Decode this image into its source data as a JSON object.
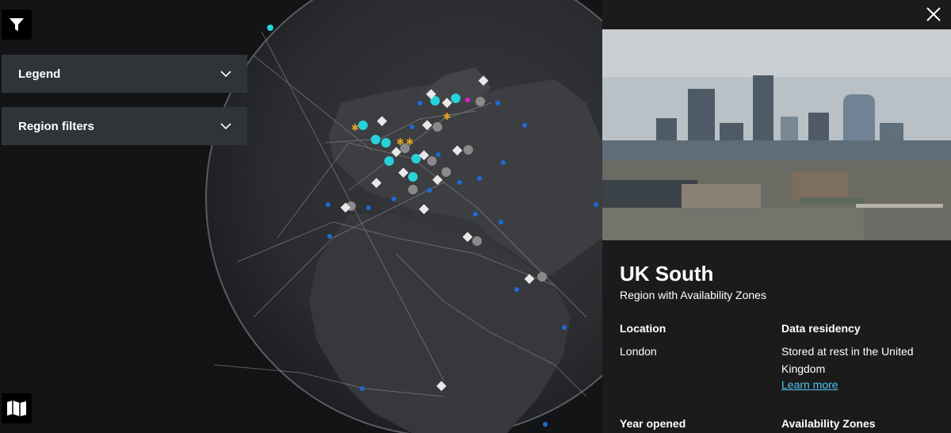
{
  "toolbar": {
    "filter_icon": "filter-icon",
    "map_icon": "map-icon"
  },
  "accordions": {
    "legend_label": "Legend",
    "region_filters_label": "Region filters"
  },
  "panel": {
    "close_icon": "close-icon",
    "region_name": "UK South",
    "region_type": "Region with Availability Zones",
    "location_label": "Location",
    "location_value": "London",
    "data_residency_label": "Data residency",
    "data_residency_value": "Stored at rest in the United Kingdom",
    "learn_more": "Learn more",
    "year_opened_label": "Year opened",
    "availability_zones_label": "Availability Zones"
  },
  "colors": {
    "accordion_bg": "#2f3438",
    "panel_bg": "#1b1b1c",
    "link": "#50c8f0",
    "az_region": "#27d3d8",
    "edge_site": "#1e6bd6",
    "planned_region": "#e8e8e8",
    "other_region": "#8a8a8a"
  }
}
